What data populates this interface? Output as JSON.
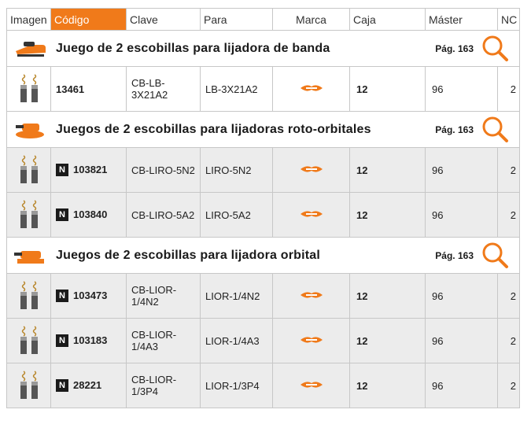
{
  "headers": {
    "imagen": "Imagen",
    "codigo": "Código",
    "clave": "Clave",
    "para": "Para",
    "marca": "Marca",
    "caja": "Caja",
    "master": "Máster",
    "nc": "NC"
  },
  "colors": {
    "accent": "#f07a1a",
    "row_grey": "#ececec",
    "border": "#c7c7c7"
  },
  "sections": [
    {
      "title": "Juego de 2 escobillas para lijadora de banda",
      "page": "Pág. 163",
      "icon": "belt-sander-icon",
      "rows": [
        {
          "new": false,
          "code": "13461",
          "clave": "CB-LB-3X21A2",
          "para": "LB-3X21A2",
          "caja": "12",
          "master": "96",
          "nc": "2"
        }
      ]
    },
    {
      "title": "Juegos de 2 escobillas para lijadoras roto-orbitales",
      "page": "Pág. 163",
      "icon": "random-orbital-sander-icon",
      "rows": [
        {
          "new": true,
          "badge": "N",
          "code": "103821",
          "clave": "CB-LIRO-5N2",
          "para": "LIRO-5N2",
          "caja": "12",
          "master": "96",
          "nc": "2"
        },
        {
          "new": true,
          "badge": "N",
          "code": "103840",
          "clave": "CB-LIRO-5A2",
          "para": "LIRO-5A2",
          "caja": "12",
          "master": "96",
          "nc": "2"
        }
      ]
    },
    {
      "title": "Juegos de 2 escobillas para lijadora orbital",
      "page": "Pág. 163",
      "icon": "orbital-sander-icon",
      "rows": [
        {
          "new": true,
          "badge": "N",
          "code": "103473",
          "clave": "CB-LIOR-1/4N2",
          "para": "LIOR-1/4N2",
          "caja": "12",
          "master": "96",
          "nc": "2"
        },
        {
          "new": true,
          "badge": "N",
          "code": "103183",
          "clave": "CB-LIOR-1/4A3",
          "para": "LIOR-1/4A3",
          "caja": "12",
          "master": "96",
          "nc": "2"
        },
        {
          "new": true,
          "badge": "N",
          "code": "28221",
          "clave": "CB-LIOR-1/3P4",
          "para": "LIOR-1/3P4",
          "caja": "12",
          "master": "96",
          "nc": "2"
        }
      ]
    }
  ]
}
